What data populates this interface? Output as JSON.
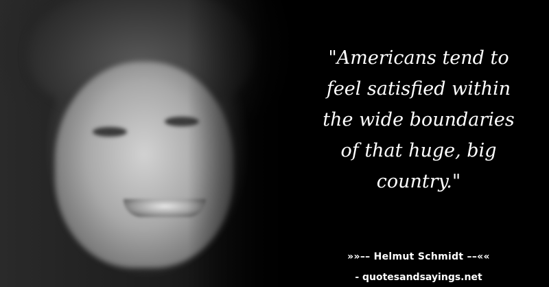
{
  "quote": {
    "lines": [
      "\"Americans tend to",
      "feel satisfied within",
      "the wide boundaries",
      "of that huge, big",
      "country.\""
    ]
  },
  "author_line": "»»–– Helmut Schmidt ––««",
  "source_line": "- quotesandsayings.net",
  "colors": {
    "background": "#000000",
    "text": "#ffffff"
  }
}
